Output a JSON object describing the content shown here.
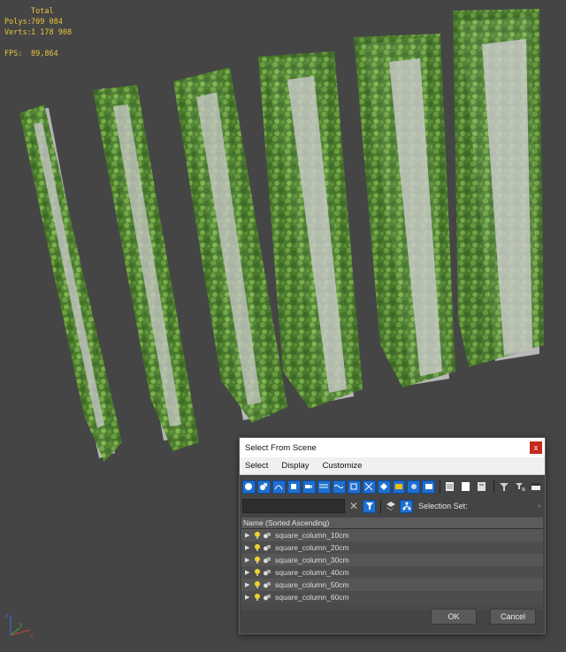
{
  "viewport": {
    "stats": {
      "total_label": "Total",
      "polys_label": "Polys:",
      "polys_value": "709 084",
      "verts_label": "Verts:",
      "verts_value": "1 178 908",
      "fps_label": "FPS:",
      "fps_value": "89,864"
    },
    "axis": {
      "x": "x",
      "y": "y",
      "z": "z"
    }
  },
  "dialog": {
    "title": "Select From Scene",
    "close": "x",
    "menu": [
      "Select",
      "Display",
      "Customize"
    ],
    "toolbar_icons": [
      "sphere-icon",
      "geometry-icon",
      "shapes-icon",
      "lights-icon",
      "cameras-icon",
      "helpers-icon",
      "spacewarps-icon",
      "groups-icon",
      "xrefs-icon",
      "bones-icon",
      "containers-icon",
      "frozen-icon",
      "list-view-icon",
      "page-icon",
      "columns-icon",
      "filter-icon",
      "filter-options-icon",
      "layout-icon"
    ],
    "search": {
      "value": "",
      "placeholder": ""
    },
    "clear": "✕",
    "selection_set_label": "Selection Set:",
    "more": "»",
    "column_header": "Name (Sorted Ascending)",
    "rows": [
      "square_column_10cm",
      "square_column_20cm",
      "square_column_30cm",
      "square_column_40cm",
      "square_column_50cm",
      "square_column_60cm"
    ],
    "ok": "OK",
    "cancel": "Cancel"
  },
  "colors": {
    "stats": "#e8c440",
    "accent": "#1e6fd0",
    "close": "#c42b1c",
    "ivy": "#4f8a2e",
    "concrete": "#b9b9b9"
  }
}
